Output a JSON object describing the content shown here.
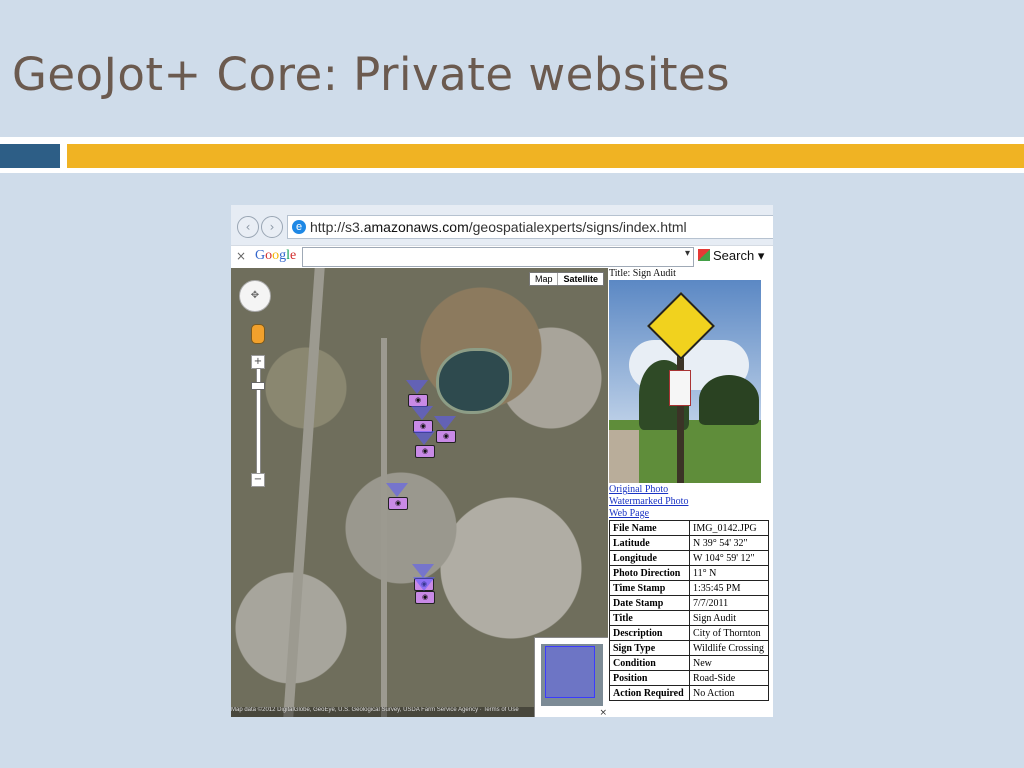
{
  "slide": {
    "title": "GeoJot+ Core: Private websites"
  },
  "colors": {
    "background": "#cfdcea",
    "title": "#6b5a4f",
    "accent_blue": "#2d5e86",
    "accent_gold": "#f0b323"
  },
  "browser": {
    "url_prefix": "http://s3.",
    "url_domain": "amazonaws.com",
    "url_path": "/geospatialexperts/signs/index.html",
    "toolbar_close": "×",
    "google_logo": "Google",
    "search_label": "Search"
  },
  "map": {
    "type_map": "Map",
    "type_satellite": "Satellite",
    "zoom_in": "+",
    "zoom_out": "−",
    "copyright": "Map data ©2012 DigitalGlobe, GeoEye, U.S. Geological Survey, USDA Farm Service Agency · Terms of Use",
    "overview_close": "×"
  },
  "info": {
    "title": "Title: Sign Audit",
    "links": [
      "Original Photo",
      "Watermarked Photo",
      "Web Page"
    ],
    "attributes": [
      {
        "key": "File Name",
        "value": "IMG_0142.JPG"
      },
      {
        "key": "Latitude",
        "value": "N 39° 54' 32\""
      },
      {
        "key": "Longitude",
        "value": "W 104° 59' 12\""
      },
      {
        "key": "Photo Direction",
        "value": "11° N"
      },
      {
        "key": "Time Stamp",
        "value": "1:35:45 PM"
      },
      {
        "key": "Date Stamp",
        "value": "7/7/2011"
      },
      {
        "key": "Title",
        "value": "Sign Audit"
      },
      {
        "key": "Description",
        "value": "City of Thornton"
      },
      {
        "key": "Sign Type",
        "value": "Wildlife Crossing"
      },
      {
        "key": "Condition",
        "value": "New"
      },
      {
        "key": "Position",
        "value": "Road-Side"
      },
      {
        "key": "Action Required",
        "value": "No Action"
      }
    ]
  }
}
